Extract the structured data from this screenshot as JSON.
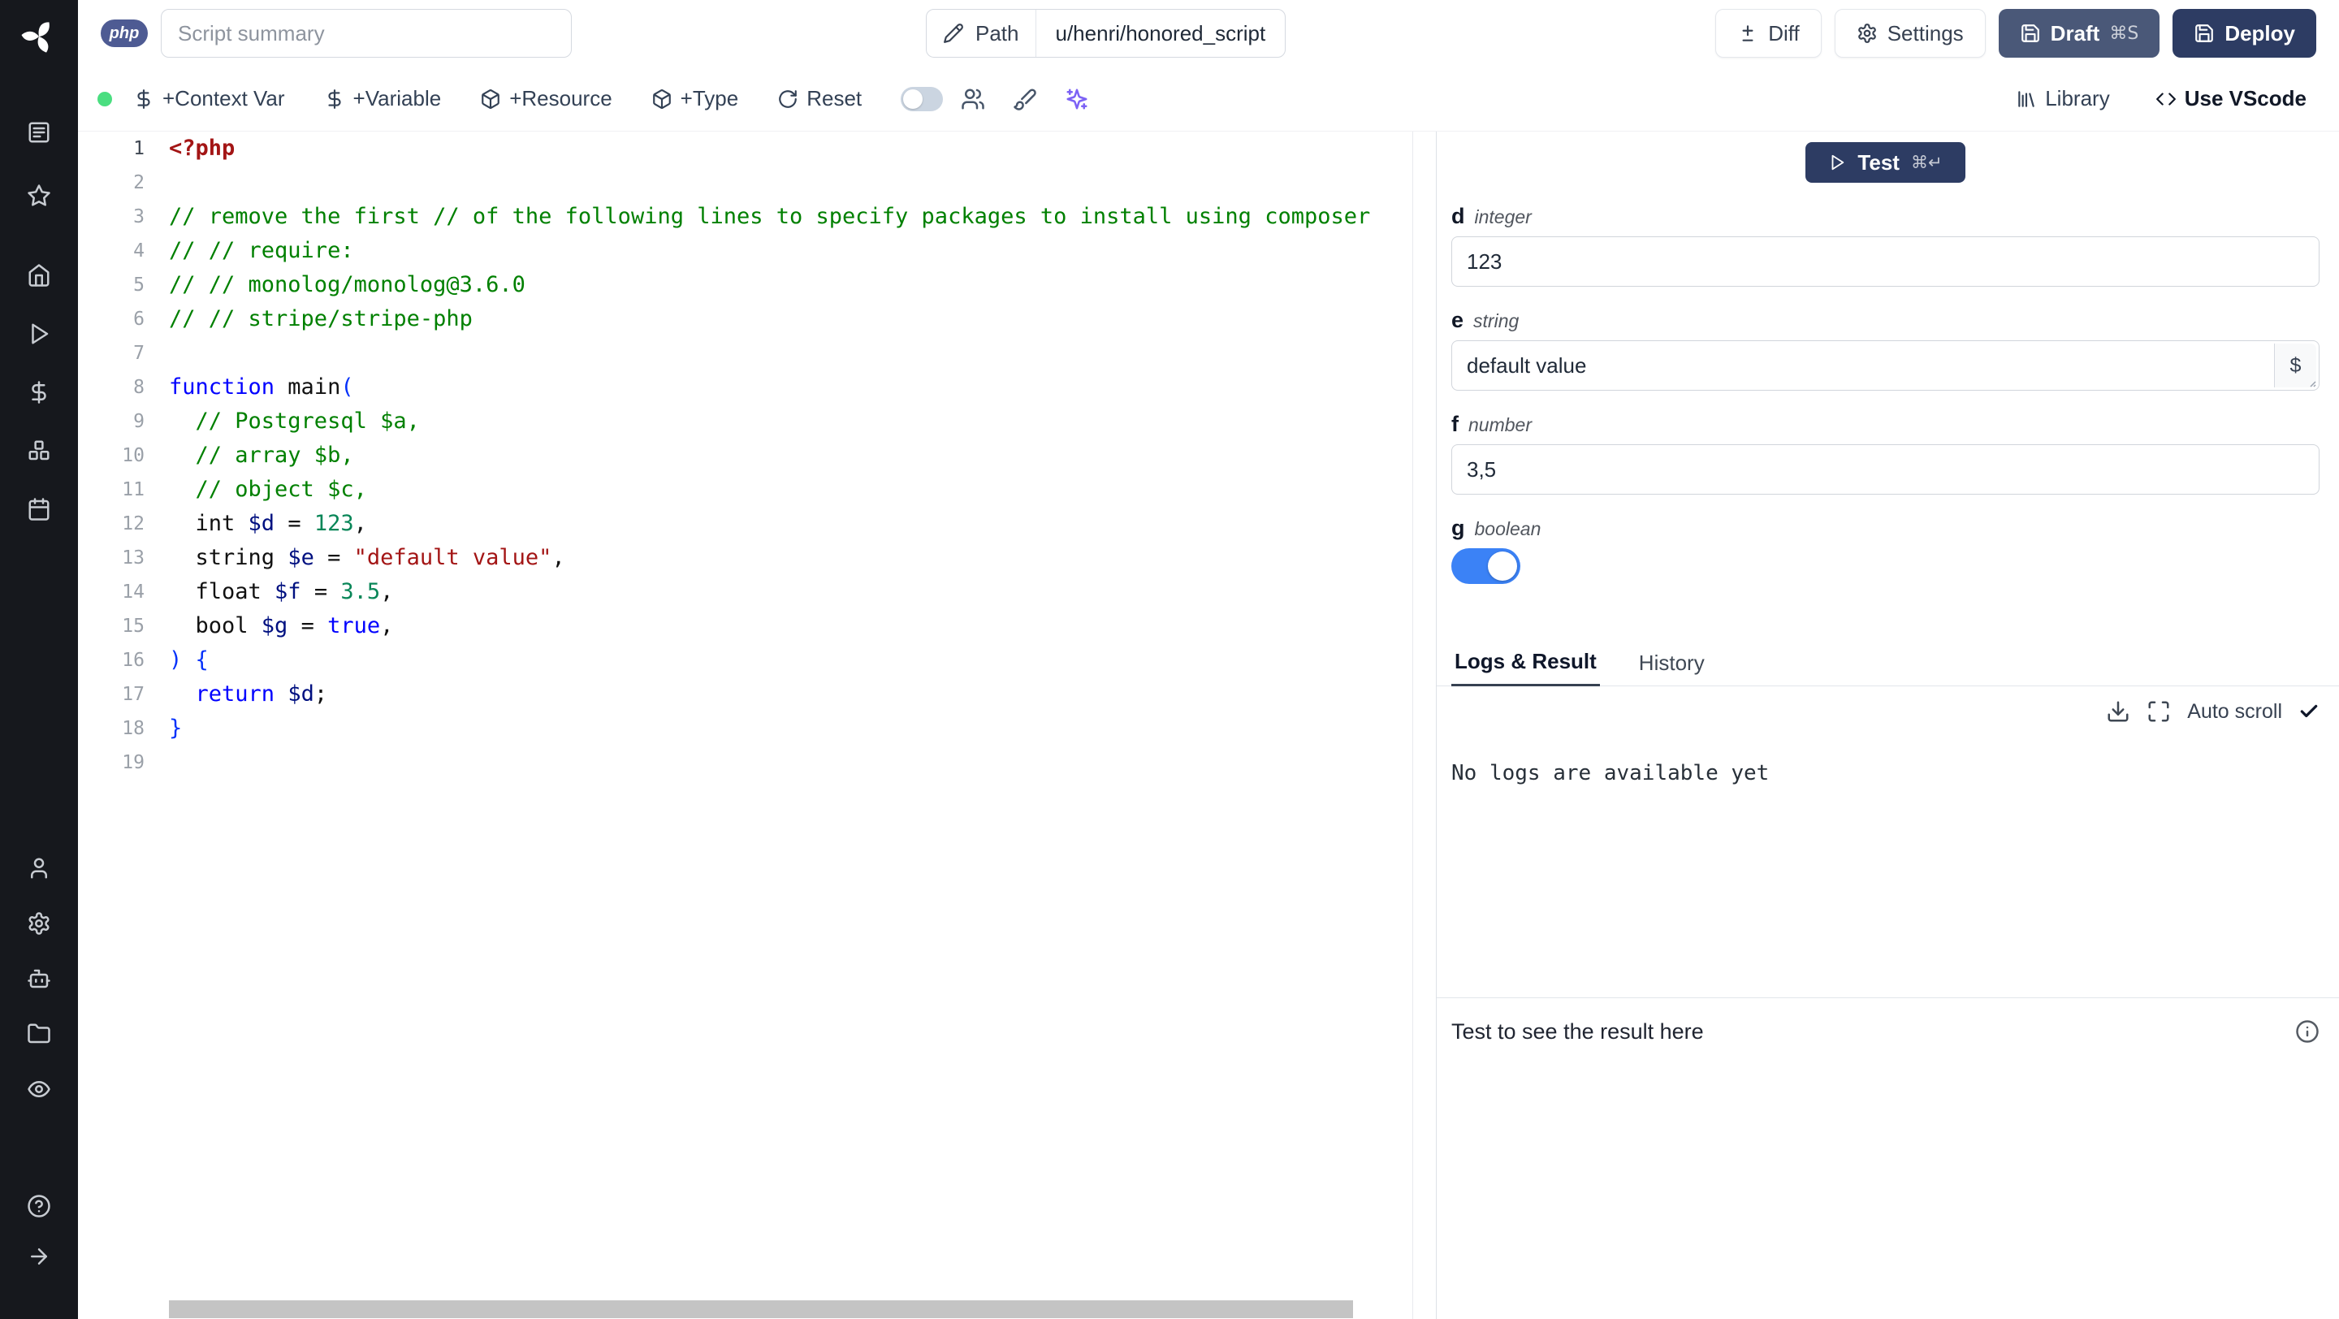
{
  "colors": {
    "accent_blue": "#3b82f6",
    "dark_navy_button": "#2d3c63",
    "draft_button": "#4a5878",
    "sidebar_bg": "#16181d",
    "status_green": "#4ade80",
    "sparkles_violet": "#7c62f5",
    "php_badge_bg": "#4e5b93"
  },
  "sidebar": {
    "icons": [
      "windmill-logo",
      "workspace",
      "favorites-star",
      "home",
      "runs-play",
      "variables-dollar",
      "resources-boxes",
      "schedules-calendar",
      "user",
      "settings-gear",
      "workers-bot",
      "folders",
      "audit-eye",
      "help",
      "expand-arrow"
    ]
  },
  "topbar": {
    "php_badge": "php",
    "summary_placeholder": "Script summary",
    "path_label": "Path",
    "path_value": "u/henri/honored_script",
    "diff_label": "Diff",
    "settings_label": "Settings",
    "draft_label": "Draft",
    "draft_shortcut": "⌘S",
    "deploy_label": "Deploy"
  },
  "toolbar": {
    "add_context_var": "+Context Var",
    "add_variable": "+Variable",
    "add_resource": "+Resource",
    "add_type": "+Type",
    "reset": "Reset",
    "toggle_on": false,
    "library": "Library",
    "use_vscode": "Use VScode"
  },
  "editor": {
    "language": "php",
    "lines": [
      [
        {
          "c": "tag",
          "t": "<?php"
        }
      ],
      [],
      [
        {
          "c": "cm",
          "t": "// remove the first // of the following lines to specify packages to install using composer"
        }
      ],
      [
        {
          "c": "cm",
          "t": "// // require:"
        }
      ],
      [
        {
          "c": "cm",
          "t": "// // monolog/monolog@3.6.0"
        }
      ],
      [
        {
          "c": "cm",
          "t": "// // stripe/stripe-php"
        }
      ],
      [],
      [
        {
          "c": "kw",
          "t": "function"
        },
        {
          "c": "def",
          "t": " main"
        },
        {
          "c": "br",
          "t": "("
        }
      ],
      [
        {
          "c": "cm",
          "t": "  // Postgresql $a,"
        }
      ],
      [
        {
          "c": "cm",
          "t": "  // array $b,"
        }
      ],
      [
        {
          "c": "cm",
          "t": "  // object $c,"
        }
      ],
      [
        {
          "c": "def",
          "t": "  int "
        },
        {
          "c": "var",
          "t": "$d"
        },
        {
          "c": "def",
          "t": " = "
        },
        {
          "c": "num",
          "t": "123"
        },
        {
          "c": "def",
          "t": ","
        }
      ],
      [
        {
          "c": "def",
          "t": "  string "
        },
        {
          "c": "var",
          "t": "$e"
        },
        {
          "c": "def",
          "t": " = "
        },
        {
          "c": "str",
          "t": "\"default value\""
        },
        {
          "c": "def",
          "t": ","
        }
      ],
      [
        {
          "c": "def",
          "t": "  float "
        },
        {
          "c": "var",
          "t": "$f"
        },
        {
          "c": "def",
          "t": " = "
        },
        {
          "c": "num",
          "t": "3.5"
        },
        {
          "c": "def",
          "t": ","
        }
      ],
      [
        {
          "c": "def",
          "t": "  bool "
        },
        {
          "c": "var",
          "t": "$g"
        },
        {
          "c": "def",
          "t": " = "
        },
        {
          "c": "kw",
          "t": "true"
        },
        {
          "c": "def",
          "t": ","
        }
      ],
      [
        {
          "c": "br",
          "t": ") {"
        }
      ],
      [
        {
          "c": "def",
          "t": "  "
        },
        {
          "c": "kw",
          "t": "return"
        },
        {
          "c": "def",
          "t": " "
        },
        {
          "c": "var",
          "t": "$d"
        },
        {
          "c": "def",
          "t": ";"
        }
      ],
      [
        {
          "c": "br",
          "t": "}"
        }
      ],
      []
    ]
  },
  "panel": {
    "test_label": "Test",
    "test_shortcut": "⌘↵",
    "fields": [
      {
        "name": "d",
        "type": "integer",
        "value": "123"
      },
      {
        "name": "e",
        "type": "string",
        "value": "default value"
      },
      {
        "name": "f",
        "type": "number",
        "value": "3,5"
      },
      {
        "name": "g",
        "type": "boolean",
        "value": true
      }
    ],
    "currency_button": "$",
    "tabs": {
      "logs": "Logs & Result",
      "history": "History"
    },
    "auto_scroll": "Auto scroll",
    "no_logs": "No logs are available yet",
    "result_hint": "Test to see the result here"
  }
}
